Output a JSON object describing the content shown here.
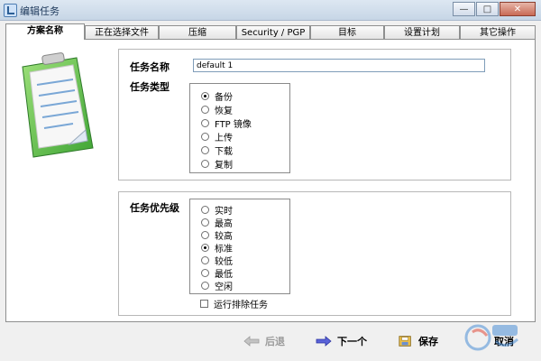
{
  "window": {
    "title": "编辑任务",
    "controls": {
      "minimize": "—",
      "maximize": "□",
      "close": "✕"
    }
  },
  "tabs": [
    {
      "label": "方案名称",
      "active": true
    },
    {
      "label": "正在选择文件",
      "active": false
    },
    {
      "label": "压缩",
      "active": false
    },
    {
      "label": "Security / PGP",
      "active": false
    },
    {
      "label": "目标",
      "active": false
    },
    {
      "label": "设置计划",
      "active": false
    },
    {
      "label": "其它操作",
      "active": false
    }
  ],
  "task": {
    "name_label": "任务名称",
    "name_value": "default 1",
    "type_label": "任务类型",
    "types": [
      {
        "label": "备份",
        "selected": true
      },
      {
        "label": "恢复",
        "selected": false
      },
      {
        "label": "FTP 镜像",
        "selected": false
      },
      {
        "label": "上传",
        "selected": false
      },
      {
        "label": "下载",
        "selected": false
      },
      {
        "label": "复制",
        "selected": false
      }
    ]
  },
  "priority": {
    "label": "任务优先级",
    "options": [
      {
        "label": "实时",
        "selected": false
      },
      {
        "label": "最高",
        "selected": false
      },
      {
        "label": "较高",
        "selected": false
      },
      {
        "label": "标准",
        "selected": true
      },
      {
        "label": "较低",
        "selected": false
      },
      {
        "label": "最低",
        "selected": false
      },
      {
        "label": "空闲",
        "selected": false
      }
    ],
    "exclusive_label": "运行排除任务",
    "exclusive_checked": false
  },
  "footer": {
    "back_label": "后退",
    "next_label": "下一个",
    "save_label": "保存",
    "cancel_label": "取消"
  },
  "icons": {
    "clipboard": "clipboard-icon",
    "back": "arrow-left-icon",
    "next": "arrow-right-icon",
    "save": "save-icon"
  },
  "colors": {
    "accent": "#2c5f96",
    "arrow_next": "#3b48c6",
    "disabled": "#9a9a9a"
  }
}
